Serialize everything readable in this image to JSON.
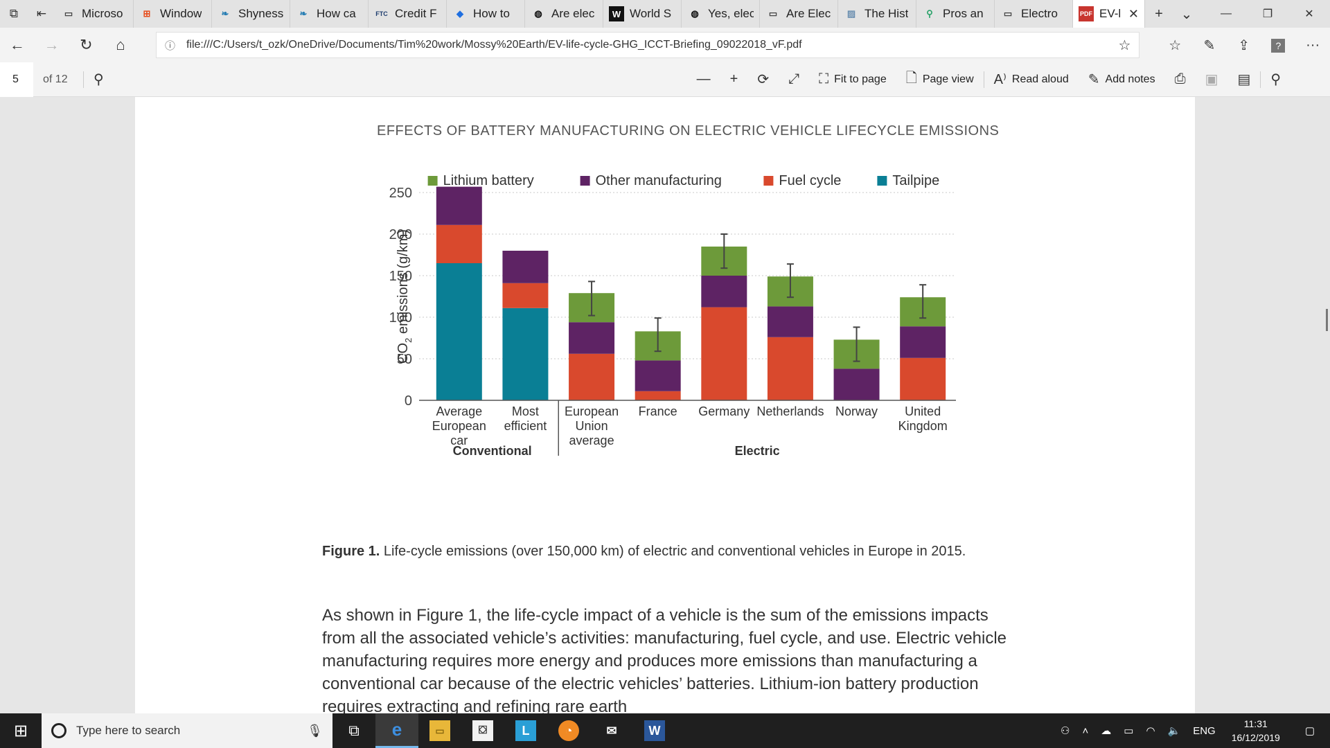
{
  "browser": {
    "tabs": [
      {
        "label": "Microso",
        "icon": "page-icon"
      },
      {
        "label": "Window",
        "icon": "windows-logo-icon"
      },
      {
        "label": "Shyness",
        "icon": "hummingbird-icon"
      },
      {
        "label": "How ca",
        "icon": "hummingbird-icon"
      },
      {
        "label": "Credit F",
        "icon": "ftc-icon"
      },
      {
        "label": "How to",
        "icon": "dropbox-icon"
      },
      {
        "label": "Are elec",
        "icon": "circle-f-icon"
      },
      {
        "label": "World S",
        "icon": "wef-icon"
      },
      {
        "label": "Yes, elec",
        "icon": "circle-f-icon"
      },
      {
        "label": "Are Elec",
        "icon": "page-icon"
      },
      {
        "label": "The Hist",
        "icon": "image-icon"
      },
      {
        "label": "Pros an",
        "icon": "map-pin-icon"
      },
      {
        "label": "Electro",
        "icon": "page-icon"
      }
    ],
    "active_tab": {
      "label": "EV-l",
      "icon": "pdf-icon"
    },
    "url": "file:///C:/Users/t_ozk/OneDrive/Documents/Tim%20work/Mossy%20Earth/EV-life-cycle-GHG_ICCT-Briefing_09022018_vF.pdf"
  },
  "pdf_toolbar": {
    "page_number": "5",
    "page_count": "of 12",
    "fit_label": "Fit to page",
    "page_view_label": "Page view",
    "read_aloud_label": "Read aloud",
    "add_notes_label": "Add notes"
  },
  "document": {
    "figure_title": "EFFECTS OF BATTERY MANUFACTURING ON ELECTRIC VEHICLE LIFECYCLE EMISSIONS",
    "caption_bold": "Figure 1.",
    "caption_text": " Life-cycle emissions (over 150,000 km) of electric and conventional vehicles in Europe in 2015.",
    "body_text": "As shown in Figure 1, the life-cycle impact of a vehicle is the sum of the emissions impacts from all the associated vehicle’s activities: manufacturing, fuel cycle, and use. Electric vehicle manufacturing requires more energy and produces more emissions than manufacturing a conventional car because of the electric vehicles’ batteries. Lithium-ion battery production requires extracting and refining rare earth"
  },
  "chart_data": {
    "type": "bar",
    "stacked": true,
    "title": "EFFECTS OF BATTERY MANUFACTURING ON ELECTRIC VEHICLE LIFECYCLE EMISSIONS",
    "ylabel_main": "CO",
    "ylabel_sub": "2",
    "ylabel_rest": " emissions (g/km)",
    "ylim": [
      0,
      250
    ],
    "yticks": [
      "0",
      "50",
      "100",
      "150",
      "200",
      "250"
    ],
    "grid": "horizontal dotted",
    "legend_position": "top",
    "categories": [
      [
        "Average",
        "European",
        "car"
      ],
      [
        "Most",
        "efficient"
      ],
      [
        "European",
        "Union",
        "average"
      ],
      [
        "France"
      ],
      [
        "Germany"
      ],
      [
        "Netherlands"
      ],
      [
        "Norway"
      ],
      [
        "United",
        "Kingdom"
      ]
    ],
    "groups": [
      {
        "label": "Conventional",
        "span": [
          0,
          1
        ]
      },
      {
        "label": "Electric",
        "span": [
          2,
          7
        ]
      }
    ],
    "series": [
      {
        "name": "Tailpipe",
        "color": "#0a7f95",
        "values": [
          165,
          111,
          0,
          0,
          0,
          0,
          0,
          0
        ]
      },
      {
        "name": "Fuel cycle",
        "color": "#d9492d",
        "values": [
          46,
          30,
          56,
          11,
          112,
          76,
          0,
          51
        ]
      },
      {
        "name": "Other manufacturing",
        "color": "#5e2364",
        "values": [
          46,
          39,
          38,
          37,
          38,
          37,
          38,
          38
        ]
      },
      {
        "name": "Lithium battery",
        "color": "#6d9a3a",
        "values": [
          0,
          0,
          35,
          35,
          35,
          36,
          35,
          35
        ]
      }
    ],
    "legend_order": [
      "Lithium battery",
      "Other manufacturing",
      "Fuel cycle",
      "Tailpipe"
    ],
    "error_bars": [
      null,
      null,
      {
        "low": 102,
        "high": 143
      },
      {
        "low": 59,
        "high": 99
      },
      {
        "low": 159,
        "high": 200
      },
      {
        "low": 124,
        "high": 164
      },
      {
        "low": 47,
        "high": 88
      },
      {
        "low": 99,
        "high": 139
      }
    ]
  },
  "taskbar": {
    "search_placeholder": "Type here to search",
    "language": "ENG",
    "time": "11:31",
    "date": "16/12/2019"
  }
}
